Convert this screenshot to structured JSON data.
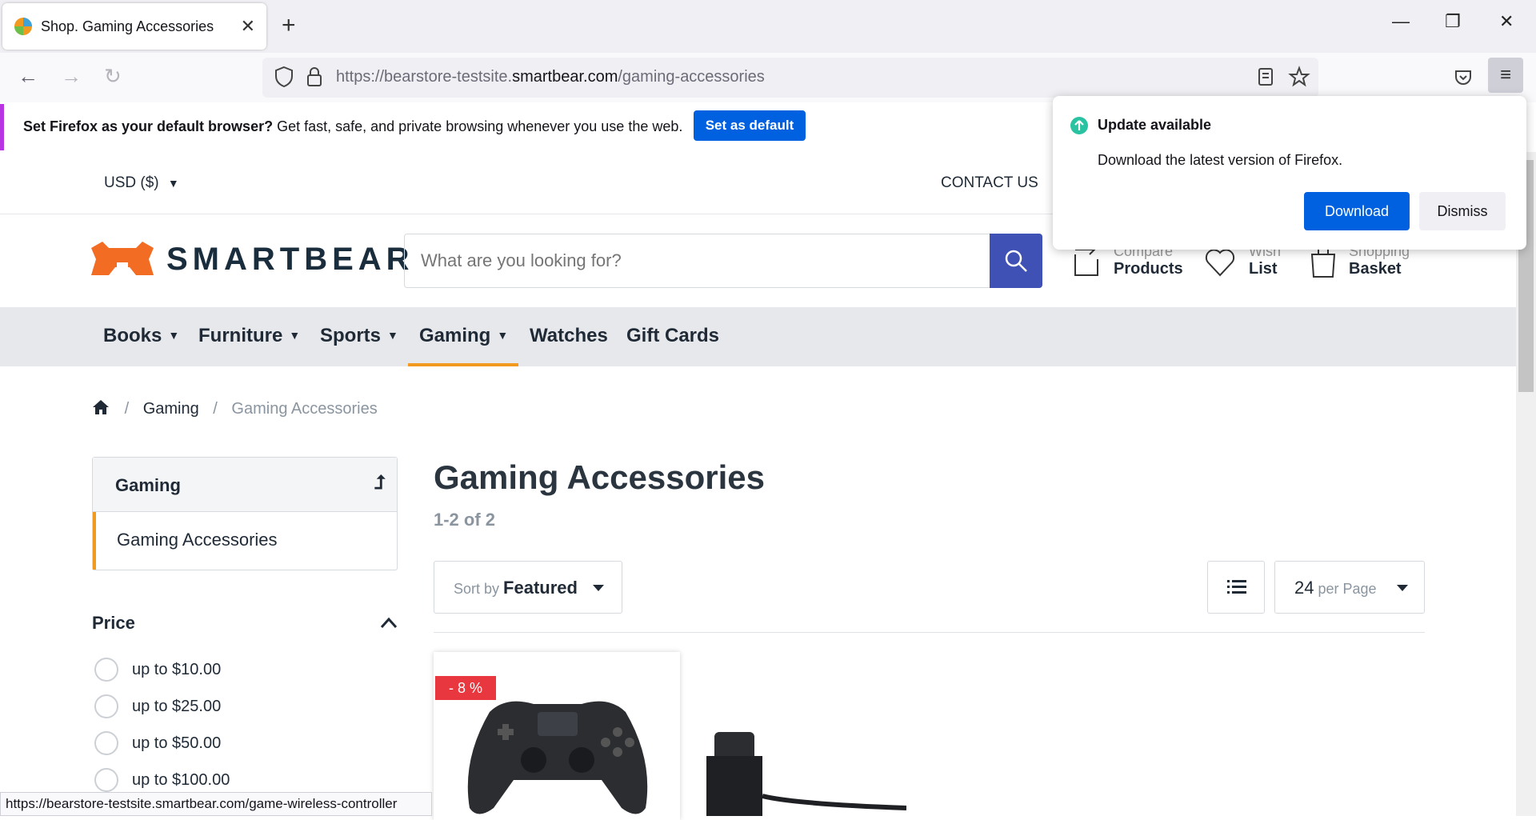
{
  "browser": {
    "tab_title": "Shop. Gaming Accessories",
    "url_prefix": "https://bearstore-testsite.",
    "url_domain": "smartbear.com",
    "url_path": "/gaming-accessories",
    "status_url": "https://bearstore-testsite.smartbear.com/game-wireless-controller"
  },
  "infobar": {
    "bold": "Set Firefox as your default browser?",
    "text": " Get fast, safe, and private browsing whenever you use the web.",
    "button": "Set as default"
  },
  "popup": {
    "title": "Update available",
    "message": "Download the latest version of Firefox.",
    "download": "Download",
    "dismiss": "Dismiss"
  },
  "topbar": {
    "currency": "USD   ($)",
    "contact": "CONTACT US"
  },
  "header": {
    "logo": "SMARTBEAR",
    "search_placeholder": "What are you looking for?",
    "compare_small": "Compare",
    "compare_big": "Products",
    "wish_small": "Wish",
    "wish_big": "List",
    "basket_small": "Shopping",
    "basket_big": "Basket"
  },
  "menu": [
    "Books",
    "Furniture",
    "Sports",
    "Gaming",
    "Watches",
    "Gift Cards"
  ],
  "breadcrumb": {
    "parent": "Gaming",
    "current": "Gaming Accessories"
  },
  "sidebar": {
    "category": "Gaming",
    "subcategory": "Gaming Accessories",
    "price_title": "Price",
    "price_options": [
      "up to $10.00",
      "up to $25.00",
      "up to $50.00",
      "up to $100.00"
    ]
  },
  "main": {
    "title": "Gaming Accessories",
    "count": "1-2 of 2",
    "sort_prefix": "Sort by",
    "sort_value": "Featured",
    "per_page_value": "24",
    "per_page_suffix": "per Page",
    "badge": "- 8 %"
  },
  "colors": {
    "accent": "#f29a1f",
    "brand_blue": "#3f51b5",
    "firefox_blue": "#0061e0",
    "sale_red": "#e8373e"
  }
}
